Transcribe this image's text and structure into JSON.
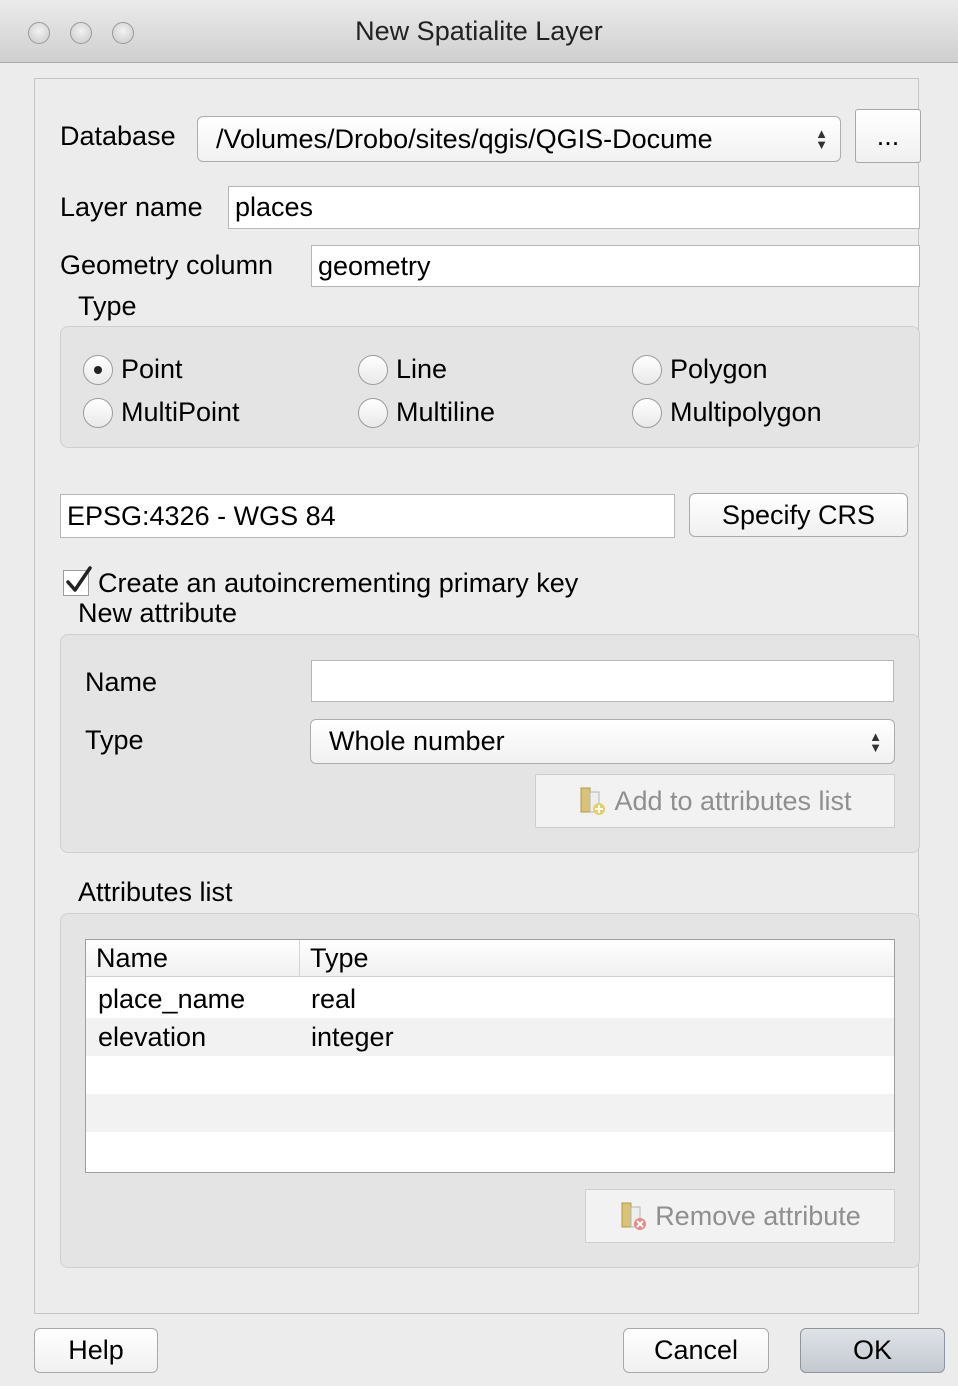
{
  "window": {
    "title": "New Spatialite Layer"
  },
  "form": {
    "database_label": "Database",
    "database_value": "/Volumes/Drobo/sites/qgis/QGIS-Docume",
    "browse_label": "...",
    "layer_name_label": "Layer name",
    "layer_name_value": "places",
    "geometry_column_label": "Geometry column",
    "geometry_column_value": "geometry"
  },
  "type_group": {
    "title": "Type",
    "options": [
      "Point",
      "Line",
      "Polygon",
      "MultiPoint",
      "Multiline",
      "Multipolygon"
    ],
    "selected": "Point"
  },
  "crs": {
    "value": "EPSG:4326 - WGS 84",
    "button_label": "Specify CRS"
  },
  "primary_key": {
    "label": "Create an autoincrementing primary key",
    "checked": true
  },
  "new_attribute": {
    "title": "New attribute",
    "name_label": "Name",
    "name_value": "",
    "type_label": "Type",
    "type_value": "Whole number",
    "add_button_label": "Add to attributes list"
  },
  "attributes_list": {
    "title": "Attributes list",
    "columns": [
      "Name",
      "Type"
    ],
    "rows": [
      {
        "name": "place_name",
        "type": "real"
      },
      {
        "name": "elevation",
        "type": "integer"
      }
    ],
    "remove_button_label": "Remove attribute"
  },
  "footer": {
    "help_label": "Help",
    "cancel_label": "Cancel",
    "ok_label": "OK"
  }
}
